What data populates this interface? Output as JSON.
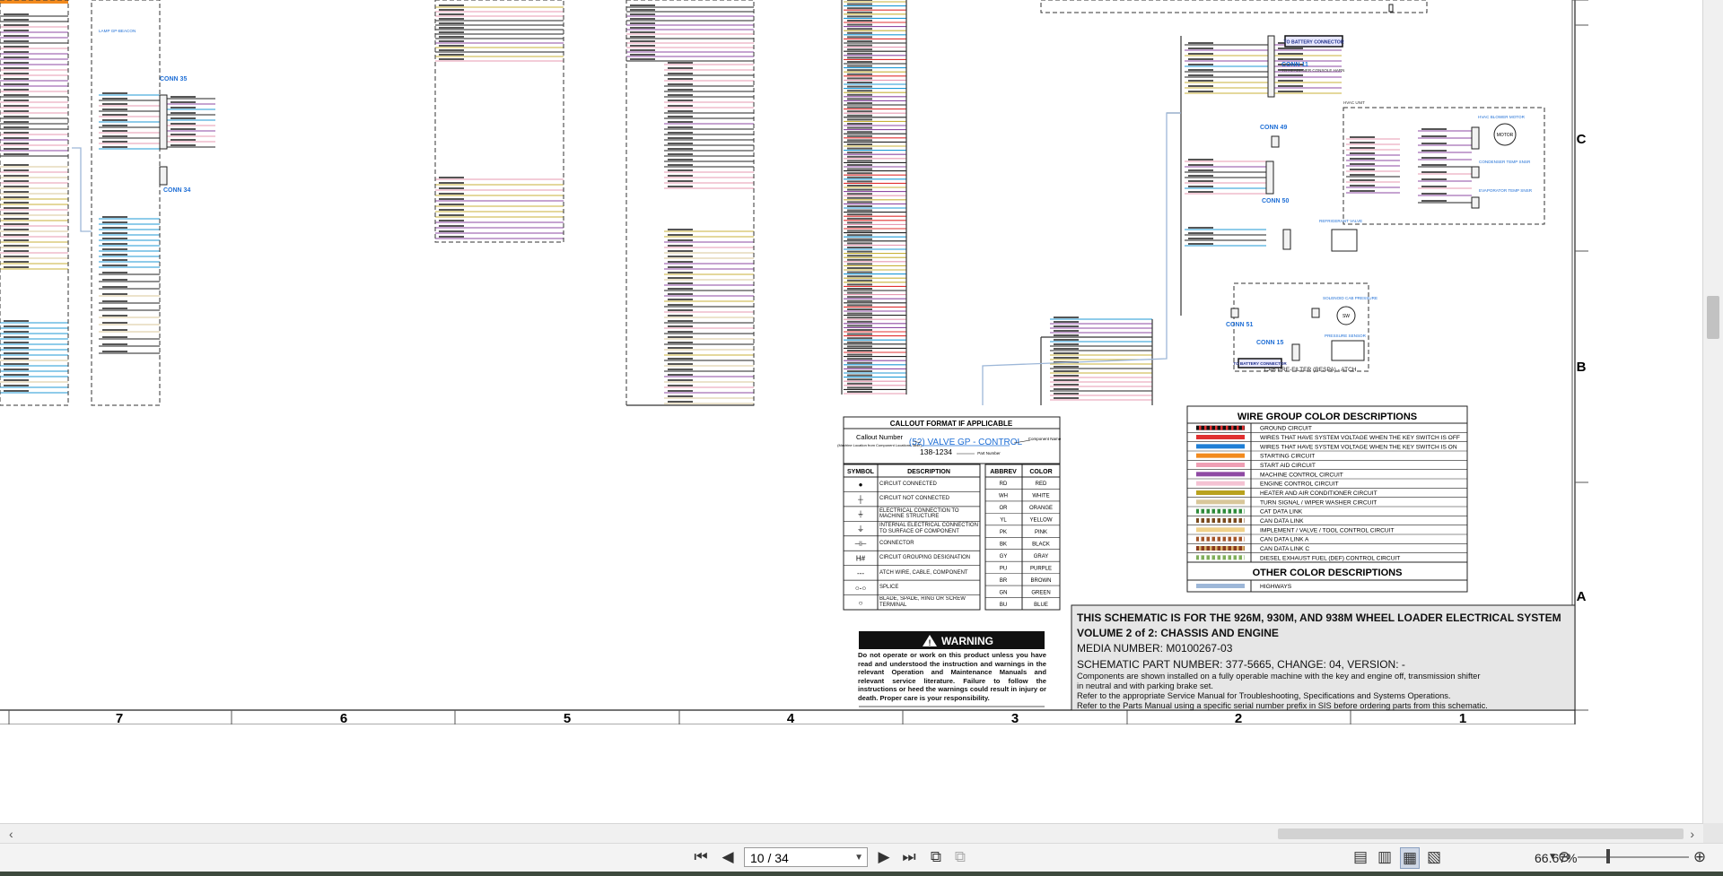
{
  "schematic": {
    "connectors": [
      "CONN 35",
      "CONN 34",
      "CONN 11",
      "CONN 49",
      "CONN 50",
      "CONN 51",
      "CONN 15"
    ],
    "to_battery_label": "TO BATTERY CONNECTOR",
    "conn11_note": "TO HEADLINER CONSOLE HARN",
    "blower_label": "HVAC BLOWER MOTOR",
    "hvac_unit_label": "HVAC UNIT",
    "motor_label": "MOTOR",
    "condenser_temp": "CONDENSER TEMP SNSR",
    "evaporator_temp": "EVAPORATOR TEMP SNSR",
    "refrigerant_valve": "REFRIGERANT VALVE",
    "pre_filter_label": "CAB PRE-FILTER (RESPA) - ATCH",
    "pressure_sensor": "PRESSURE SENSOR",
    "solenoid_label": "SOLENOID CAB PRESSURE",
    "lamp_label": "LAMP GP-BEACON"
  },
  "callout": {
    "title": "CALLOUT FORMAT IF APPLICABLE",
    "callout_number": "Callout Number",
    "callout_sub": "(Machine Location from Component Locations Table)",
    "example": "(52) VALVE GP - CONTROL",
    "component_name": "Component Name",
    "part_number": "138-1234",
    "part_number_label": "Part Number"
  },
  "symbol_table": {
    "headers": [
      "SYMBOL",
      "DESCRIPTION"
    ],
    "rows": [
      {
        "symbol": "●",
        "desc": "CIRCUIT CONNECTED"
      },
      {
        "symbol": "┼",
        "desc": "CIRCUIT NOT CONNECTED"
      },
      {
        "symbol": "⏚",
        "desc": "ELECTRICAL CONNECTION TO MACHINE STRUCTURE"
      },
      {
        "symbol": "⏚",
        "desc": "INTERNAL ELECTRICAL CONNECTION TO SURFACE OF COMPONENT"
      },
      {
        "symbol": "⊣⊢",
        "desc": "CONNECTOR"
      },
      {
        "symbol": "H#",
        "desc": "CIRCUIT GROUPING DESIGNATION"
      },
      {
        "symbol": "---",
        "desc": "ATCH WIRE, CABLE, COMPONENT"
      },
      {
        "symbol": "○-○",
        "desc": "SPLICE"
      },
      {
        "symbol": "○",
        "desc": "BLADE, SPADE, RING OR SCREW TERMINAL"
      }
    ]
  },
  "abbrev_table": {
    "headers": [
      "ABBREV",
      "COLOR"
    ],
    "rows": [
      [
        "RD",
        "RED"
      ],
      [
        "WH",
        "WHITE"
      ],
      [
        "OR",
        "ORANGE"
      ],
      [
        "YL",
        "YELLOW"
      ],
      [
        "PK",
        "PINK"
      ],
      [
        "BK",
        "BLACK"
      ],
      [
        "GY",
        "GRAY"
      ],
      [
        "PU",
        "PURPLE"
      ],
      [
        "BR",
        "BROWN"
      ],
      [
        "GN",
        "GREEN"
      ],
      [
        "BU",
        "BLUE"
      ]
    ]
  },
  "wire_group": {
    "title": "WIRE GROUP COLOR DESCRIPTIONS",
    "rows": [
      {
        "color1": "#111111",
        "color2": "#e03030",
        "label": "GROUND CIRCUIT"
      },
      {
        "color1": "#e03030",
        "color2": "#e03030",
        "label": "WIRES THAT HAVE SYSTEM VOLTAGE WHEN THE KEY SWITCH IS OFF"
      },
      {
        "color1": "#1f7fd6",
        "color2": "#1f7fd6",
        "label": "WIRES THAT HAVE SYSTEM VOLTAGE WHEN THE KEY SWITCH IS ON"
      },
      {
        "color1": "#f28a1e",
        "color2": "#f28a1e",
        "label": "STARTING CIRCUIT"
      },
      {
        "color1": "#ef9fb4",
        "color2": "#ef9fb4",
        "label": "START AID CIRCUIT"
      },
      {
        "color1": "#8e4aa3",
        "color2": "#8e4aa3",
        "label": "MACHINE CONTROL CIRCUIT"
      },
      {
        "color1": "#f4c2d3",
        "color2": "#f4c2d3",
        "label": "ENGINE CONTROL CIRCUIT"
      },
      {
        "color1": "#b9a21e",
        "color2": "#b9a21e",
        "label": "HEATER AND AIR CONDITIONER CIRCUIT"
      },
      {
        "color1": "#d8c79a",
        "color2": "#d8c79a",
        "label": "TURN SIGNAL / WIPER WASHER CIRCUIT"
      },
      {
        "color1": "#2e8a3a",
        "color2": "#ffffff",
        "label": "CAT DATA LINK"
      },
      {
        "color1": "#7a4a1e",
        "color2": "#ffffff",
        "label": "CAN DATA LINK"
      },
      {
        "color1": "#f0d18a",
        "color2": "#f0d18a",
        "label": "IMPLEMENT / VALVE / TOOL CONTROL CIRCUIT"
      },
      {
        "color1": "#a3552a",
        "color2": "#ffffff",
        "label": "CAN DATA LINK A"
      },
      {
        "color1": "#8a3a1e",
        "color2": "#d8b26a",
        "label": "CAN DATA LINK C"
      },
      {
        "color1": "#7fae5a",
        "color2": "#ffffff",
        "label": "DIESEL EXHAUST FUEL (DEF) CONTROL CIRCUIT"
      }
    ],
    "other_title": "OTHER COLOR DESCRIPTIONS",
    "other_rows": [
      {
        "color1": "#9db7d8",
        "color2": "#9db7d8",
        "label": "HIGHWAYS"
      }
    ]
  },
  "warning": {
    "title": "WARNING",
    "text": "Do not operate or work on this product unless you have read and understood the instruction and warnings in the relevant Operation and Maintenance Manuals and relevant service literature. Failure to follow the instructions or heed the warnings could result in injury or death. Proper care is your responsibility."
  },
  "info": {
    "line1": "THIS SCHEMATIC IS FOR THE 926M, 930M, AND 938M WHEEL LOADER ELECTRICAL SYSTEM",
    "line2": "VOLUME 2 of 2: CHASSIS AND ENGINE",
    "line3": "MEDIA NUMBER: M0100267-03",
    "line4": "SCHEMATIC PART NUMBER: 377-5665, CHANGE: 04, VERSION: -",
    "line5": "Components are shown installed on a fully operable machine with the key and engine off, transmission shifter",
    "line6": "in neutral and with parking brake set.",
    "line7": "Refer to the appropriate Service Manual for Troubleshooting, Specifications and Systems Operations.",
    "line8": "Refer to the Parts Manual using a specific serial number prefix in SIS before ordering parts from this schematic."
  },
  "grid": {
    "columns": [
      "7",
      "6",
      "5",
      "4",
      "3",
      "2",
      "1"
    ],
    "rows": [
      "C",
      "B",
      "A"
    ]
  },
  "toolbar": {
    "page_value": "10 / 34",
    "zoom": "66.67%"
  },
  "colors": {
    "blue_wire": "#1f9ad6",
    "pink_wire": "#e79ab2",
    "purple_wire": "#8e4aa3",
    "black_wire": "#222222",
    "yellow_wire": "#c9b23a",
    "orange_top": "#f28a1e",
    "link_blue": "#1f6fd6"
  },
  "icons": [
    "first-page-icon",
    "prev-page-icon",
    "next-page-icon",
    "last-page-icon",
    "rotate-icon",
    "fit-icon",
    "single-page-icon",
    "continuous-icon",
    "facing-icon",
    "scroll-icon",
    "zoom-out-icon",
    "zoom-in-icon"
  ]
}
